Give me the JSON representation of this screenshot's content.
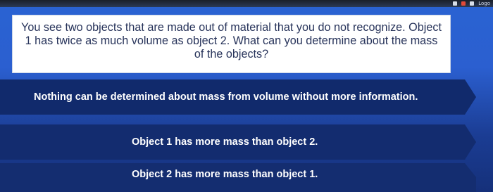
{
  "system_tray": {
    "text": "(blurred)",
    "visible_label": "Logo"
  },
  "question": {
    "text": "You see two objects that are made out of material that you do not recognize. Object 1 has twice as much volume as object 2. What can you determine about the mass of the objects?"
  },
  "options": [
    {
      "label": "Nothing can be determined about mass from volume without more information."
    },
    {
      "label": "Object 1 has more mass than object 2."
    },
    {
      "label": "Object 2 has more mass than object 1."
    }
  ],
  "colors": {
    "background": "#2a63d2",
    "option_fill": "#132b6e",
    "question_text": "#27335a",
    "card": "#ffffff"
  }
}
